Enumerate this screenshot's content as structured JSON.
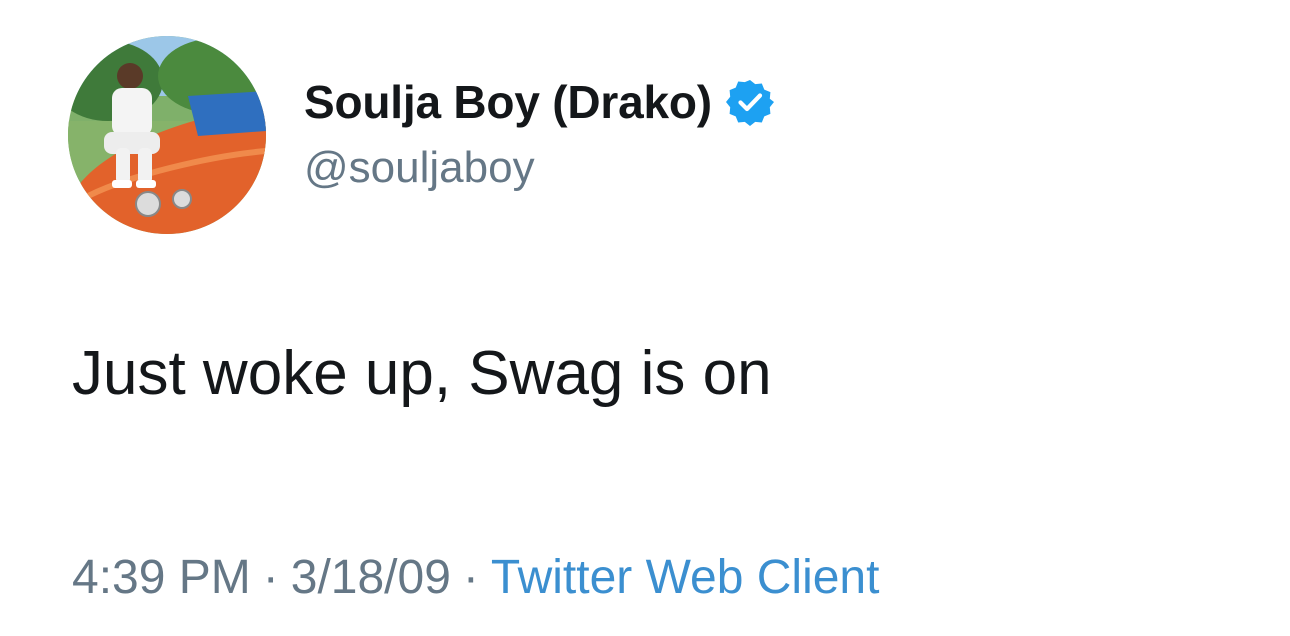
{
  "tweet": {
    "author": {
      "display_name": "Soulja Boy (Drako)",
      "handle": "@souljaboy",
      "verified_icon": "verified-badge-icon"
    },
    "text": "Just woke up, Swag is on",
    "meta": {
      "time": "4:39 PM",
      "date": "3/18/09",
      "separator": "·",
      "source": "Twitter Web Client"
    }
  },
  "colors": {
    "name": "#14171a",
    "secondary": "#657786",
    "link": "#3b8fd0",
    "verified": "#1da1f2"
  }
}
